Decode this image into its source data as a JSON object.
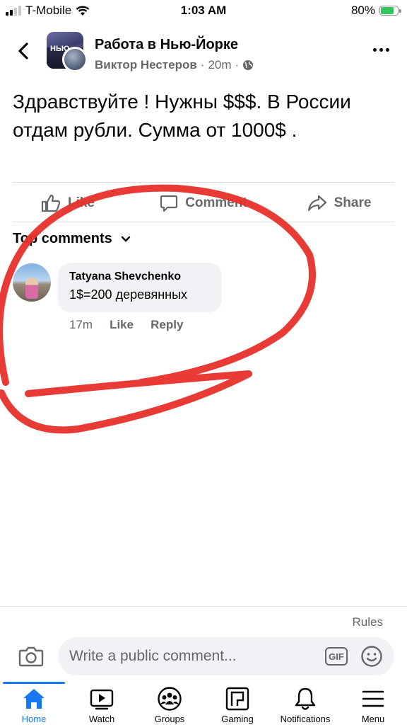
{
  "status_bar": {
    "carrier": "T-Mobile",
    "time": "1:03 AM",
    "battery": "80%",
    "battery_level": 0.8
  },
  "header": {
    "group_name": "Работа в Нью-Йорке",
    "avatar_text": "НЬЮ",
    "author": "Виктор Нестеров",
    "separator": "·",
    "time_ago": "20m",
    "icons": {
      "back": "chevron-left-icon",
      "more": "more-dots-icon",
      "audience": "globe-icon"
    }
  },
  "post": {
    "text": "Здравствуйте ! Нужны $$$. В России отдам рубли. Сумма от 1000$ ."
  },
  "actions": {
    "like": "Like",
    "comment": "Comment",
    "share": "Share"
  },
  "comments": {
    "sort_label": "Top comments",
    "items": [
      {
        "author": "Tatyana Shevchenko",
        "text": "1$=200 деревянных",
        "time": "17m",
        "like": "Like",
        "reply": "Reply"
      }
    ]
  },
  "composer": {
    "rules": "Rules",
    "placeholder": "Write a public comment...",
    "gif": "GIF"
  },
  "tabbar": {
    "tabs": [
      {
        "label": "Home",
        "icon": "home-icon",
        "active": true
      },
      {
        "label": "Watch",
        "icon": "video-icon"
      },
      {
        "label": "Groups",
        "icon": "groups-icon"
      },
      {
        "label": "Gaming",
        "icon": "gaming-icon"
      },
      {
        "label": "Notifications",
        "icon": "bell-icon"
      },
      {
        "label": "Menu",
        "icon": "hamburger-icon"
      }
    ]
  },
  "colors": {
    "accent": "#1877f2",
    "annotation": "#e8302a",
    "secondary_text": "#65676b",
    "bubble": "#f0f2f5"
  }
}
